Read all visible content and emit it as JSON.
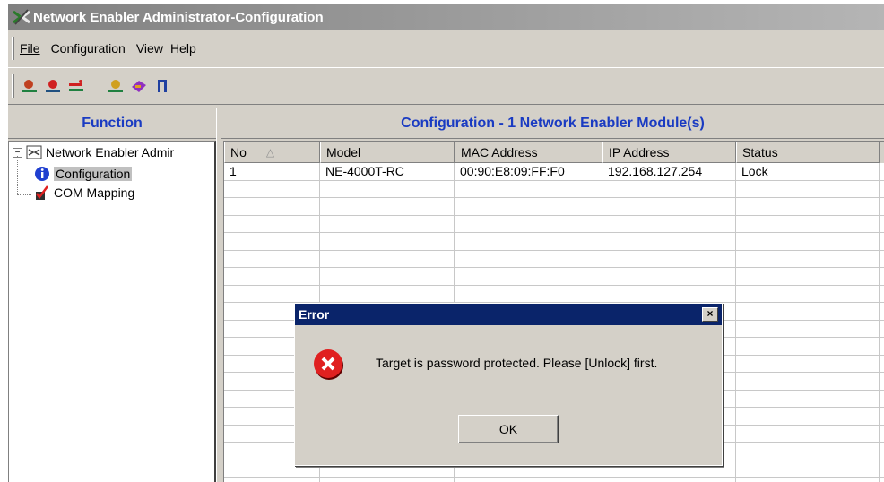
{
  "window": {
    "title": "Network Enabler Administrator-Configuration"
  },
  "menubar": {
    "items": [
      "File",
      "Configuration",
      "View",
      "Help"
    ]
  },
  "toolbar": {
    "icons": [
      "search-icon",
      "broadcast-icon",
      "disconnect-icon",
      "unlock-icon",
      "export-icon",
      "exit-icon"
    ]
  },
  "left": {
    "heading": "Function",
    "tree": {
      "root": "Network Enabler Admir",
      "expander": "−",
      "children": [
        "Configuration",
        "COM Mapping"
      ]
    }
  },
  "right": {
    "heading": "Configuration - 1 Network Enabler Module(s)",
    "columns": [
      "No",
      "Model",
      "MAC Address",
      "IP Address",
      "Status"
    ],
    "sort_indicator": "△",
    "rows": [
      [
        "1",
        "NE-4000T-RC",
        "00:90:E8:09:FF:F0",
        "192.168.127.254",
        "Lock"
      ]
    ]
  },
  "dialog": {
    "title": "Error",
    "close": "×",
    "message": "Target is password protected. Please [Unlock] first.",
    "ok_label": "OK"
  },
  "colors": {
    "accent": "#1a3bc2",
    "dialog_title": "#0a246a",
    "error": "#e02020"
  }
}
